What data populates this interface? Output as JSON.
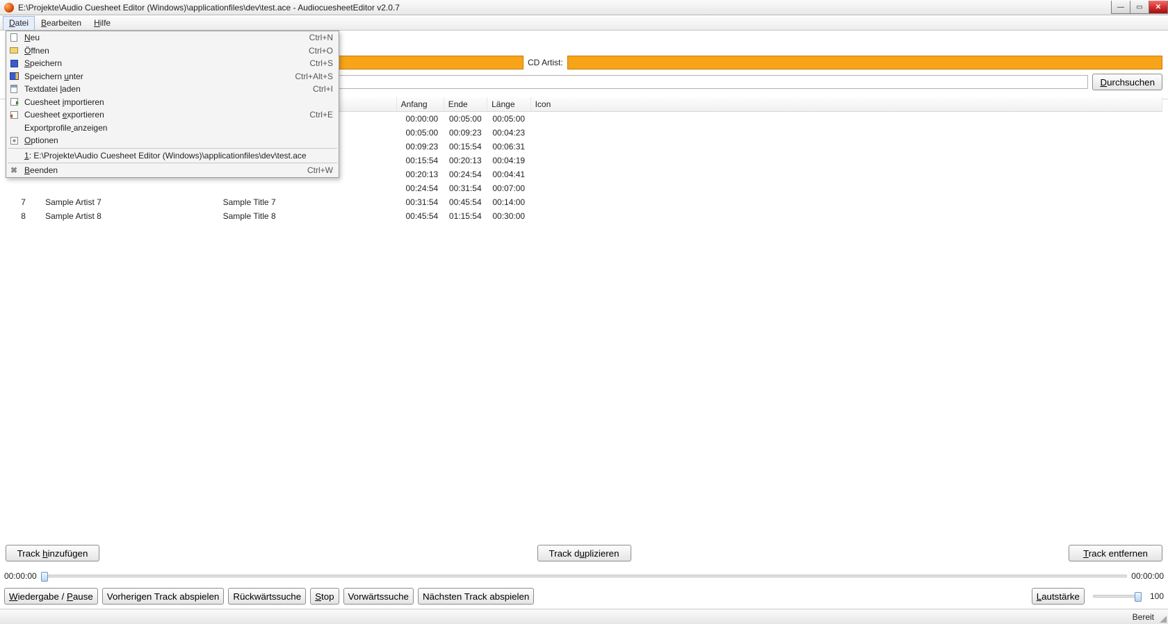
{
  "window": {
    "title": "E:\\Projekte\\Audio Cuesheet Editor (Windows)\\applicationfiles\\dev\\test.ace - AudiocuesheetEditor v2.0.7"
  },
  "menubar": {
    "items": [
      {
        "label": "Datei",
        "accesskey": "D"
      },
      {
        "label": "Bearbeiten",
        "accesskey": "B"
      },
      {
        "label": "Hilfe",
        "accesskey": "H"
      }
    ]
  },
  "file_menu": {
    "items": [
      {
        "icon": "ic-new",
        "label": "Neu",
        "u": 0,
        "accel": "Ctrl+N"
      },
      {
        "icon": "ic-open",
        "label": "Öffnen",
        "u": 0,
        "accel": "Ctrl+O"
      },
      {
        "icon": "ic-save",
        "label": "Speichern",
        "u": 0,
        "accel": "Ctrl+S"
      },
      {
        "icon": "ic-saveas",
        "label": "Speichern unter",
        "u": 10,
        "accel": "Ctrl+Alt+S"
      },
      {
        "icon": "ic-text",
        "label": "Textdatei laden",
        "u": 10,
        "accel": "Ctrl+I"
      },
      {
        "icon": "ic-cueimp",
        "label": "Cuesheet importieren",
        "u": 9,
        "accel": ""
      },
      {
        "icon": "ic-cueexp",
        "label": "Cuesheet exportieren",
        "u": 9,
        "accel": "Ctrl+E"
      },
      {
        "icon": "",
        "label": "Exportprofile anzeigen",
        "u": 13,
        "accel": ""
      },
      {
        "icon": "ic-opt",
        "label": "Optionen",
        "u": 0,
        "accel": ""
      }
    ],
    "recent": {
      "label": "1: E:\\Projekte\\Audio Cuesheet Editor (Windows)\\applicationfiles\\dev\\test.ace",
      "u": 0
    },
    "exit": {
      "icon": "ic-exit",
      "label": "Beenden",
      "u": 0,
      "accel": "Ctrl+W"
    }
  },
  "form": {
    "cd_artist_label": "CD Artist:",
    "cd_artist_value": "",
    "browse_label": "Durchsuchen"
  },
  "table": {
    "headers": {
      "num": "",
      "artist": "",
      "title": "",
      "anfang": "Anfang",
      "ende": "Ende",
      "laenge": "Länge",
      "icon": "Icon"
    },
    "rows": [
      {
        "n": "",
        "artist": "",
        "title": "",
        "a": "00:00:00",
        "e": "00:05:00",
        "l": "00:05:00"
      },
      {
        "n": "",
        "artist": "",
        "title": "",
        "a": "00:05:00",
        "e": "00:09:23",
        "l": "00:04:23"
      },
      {
        "n": "",
        "artist": "",
        "title": "",
        "a": "00:09:23",
        "e": "00:15:54",
        "l": "00:06:31"
      },
      {
        "n": "",
        "artist": "",
        "title": "",
        "a": "00:15:54",
        "e": "00:20:13",
        "l": "00:04:19"
      },
      {
        "n": "",
        "artist": "",
        "title": "",
        "a": "00:20:13",
        "e": "00:24:54",
        "l": "00:04:41"
      },
      {
        "n": "",
        "artist": "",
        "title": "",
        "a": "00:24:54",
        "e": "00:31:54",
        "l": "00:07:00"
      },
      {
        "n": "7",
        "artist": "Sample Artist 7",
        "title": "Sample Title 7",
        "a": "00:31:54",
        "e": "00:45:54",
        "l": "00:14:00"
      },
      {
        "n": "8",
        "artist": "Sample Artist 8",
        "title": "Sample Title 8",
        "a": "00:45:54",
        "e": "01:15:54",
        "l": "00:30:00"
      }
    ]
  },
  "buttons": {
    "add": "Track hinzufügen",
    "dup": "Track duplizieren",
    "del": "Track entfernen"
  },
  "seek": {
    "start": "00:00:00",
    "end": "00:00:00"
  },
  "player": {
    "playpause": "Wiedergabe / Pause",
    "prev": "Vorherigen Track abspielen",
    "rew": "Rückwärtssuche",
    "stop": "Stop",
    "ffw": "Vorwärtssuche",
    "next": "Nächsten Track abspielen",
    "volume_label": "Lautstärke",
    "volume_value": "100"
  },
  "status": {
    "text": "Bereit"
  }
}
